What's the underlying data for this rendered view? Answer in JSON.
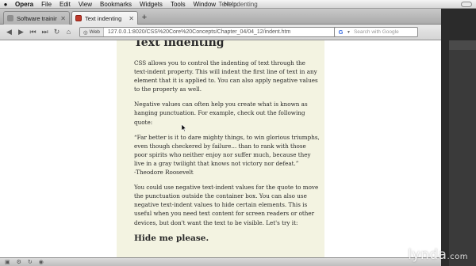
{
  "menubar": {
    "apple_icon": "apple-icon",
    "app_name": "Opera",
    "menus": [
      "File",
      "Edit",
      "View",
      "Bookmarks",
      "Widgets",
      "Tools",
      "Window",
      "Help"
    ],
    "window_title": "Text indenting"
  },
  "tabs": [
    {
      "label": "Software training onl...",
      "active": false,
      "favicon": "lynda-favicon"
    },
    {
      "label": "Text indenting",
      "active": true,
      "favicon": "page-favicon"
    }
  ],
  "navbar": {
    "web_badge": "Web",
    "url": "127.0.0.1:8020/CSS%20Core%20Concepts/Chapter_04/04_12/indent.htm",
    "search_placeholder": "Search with Google"
  },
  "page": {
    "heading": "Text indenting",
    "paragraphs": [
      "CSS allows you to control the indenting of text through the text-indent property. This will indent the first line of text in any element that it is applied to. You can also apply negative values to the property as well.",
      "Negative values can often help you create what is known as hanging punctuation. For example, check out the following quote:",
      "“Far better is it to dare mighty things, to win glorious triumphs, even though checkered by failure... than to rank with those poor spirits who neither enjoy nor suffer much, because they live in a gray twilight that knows not victory nor defeat.”",
      "-Theodore Roosevelt",
      "You could use negative text-indent values for the quote to move the punctuation outside the container box. You can also use negative text-indent values to hide certain elements. This is useful when you need text content for screen readers or other devices, but don't want the text to be visible. Let's try it:"
    ],
    "subheading": "Hide me please."
  },
  "watermark": {
    "brand": "lynda",
    "suffix": ".com"
  },
  "colors": {
    "page_column": "#f3f3e1",
    "active_tab": "#f0f0f0",
    "favicon_red": "#c0392b"
  }
}
